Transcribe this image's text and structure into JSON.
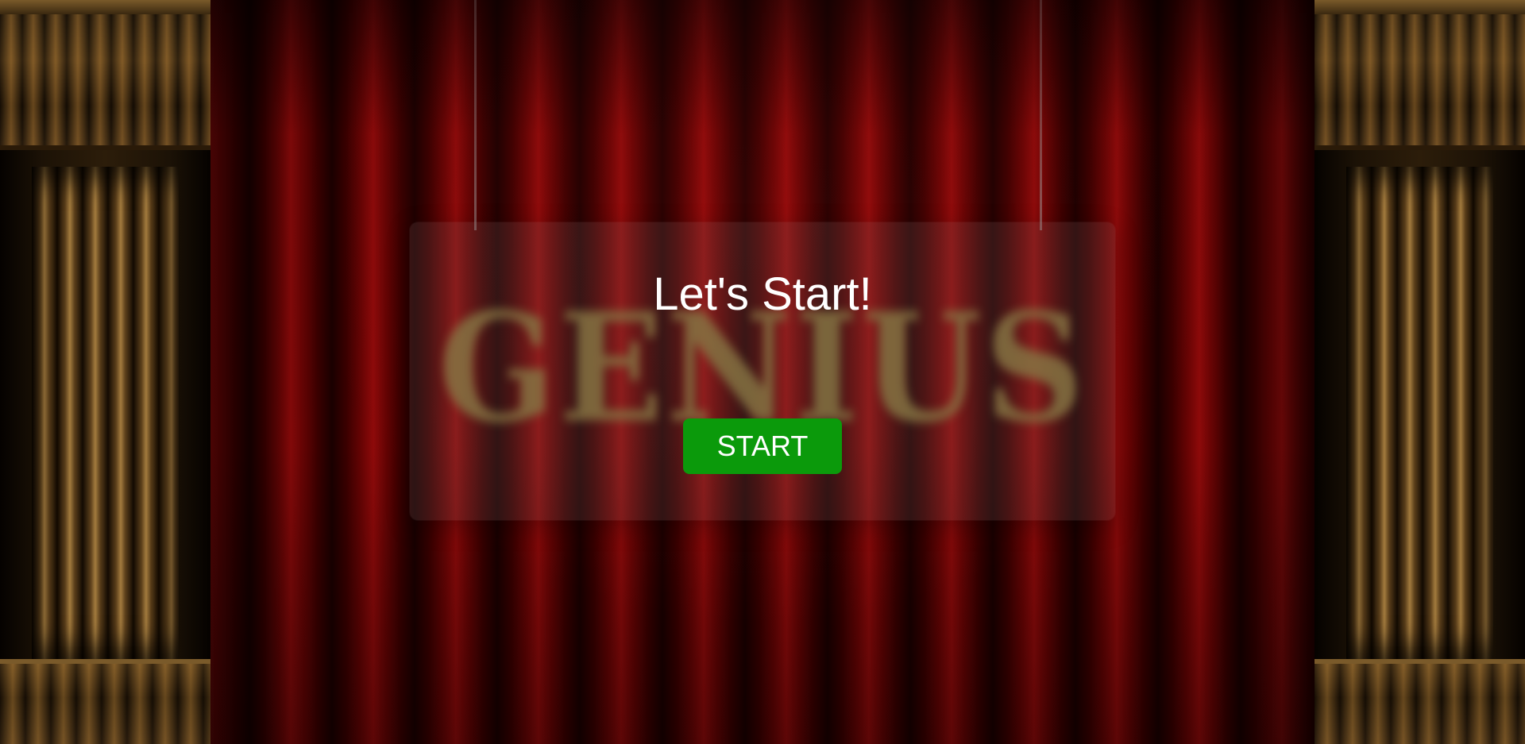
{
  "background": {
    "title": "GENIUS"
  },
  "dialog": {
    "title": "Let's Start!",
    "start_label": "START"
  },
  "colors": {
    "curtain": "#8e0a0a",
    "button": "#0b9a0b",
    "title_text": "#ffffff",
    "background_title": "#8a7a3c"
  }
}
